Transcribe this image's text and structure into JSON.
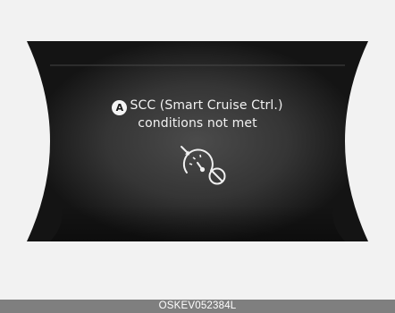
{
  "display": {
    "marker_label": "A",
    "message_line1": "SCC (Smart Cruise Ctrl.)",
    "message_line2": "conditions not met",
    "icon": "smart-cruise-control-unavailable-icon"
  },
  "footer": {
    "code": "OSKEV052384L"
  },
  "colors": {
    "page_background": "#f2f2f2",
    "display_edge": "#151515",
    "display_center": "#4a4a4a",
    "text": "#f2f2f2",
    "footer_bar": "#7f7f7f"
  }
}
